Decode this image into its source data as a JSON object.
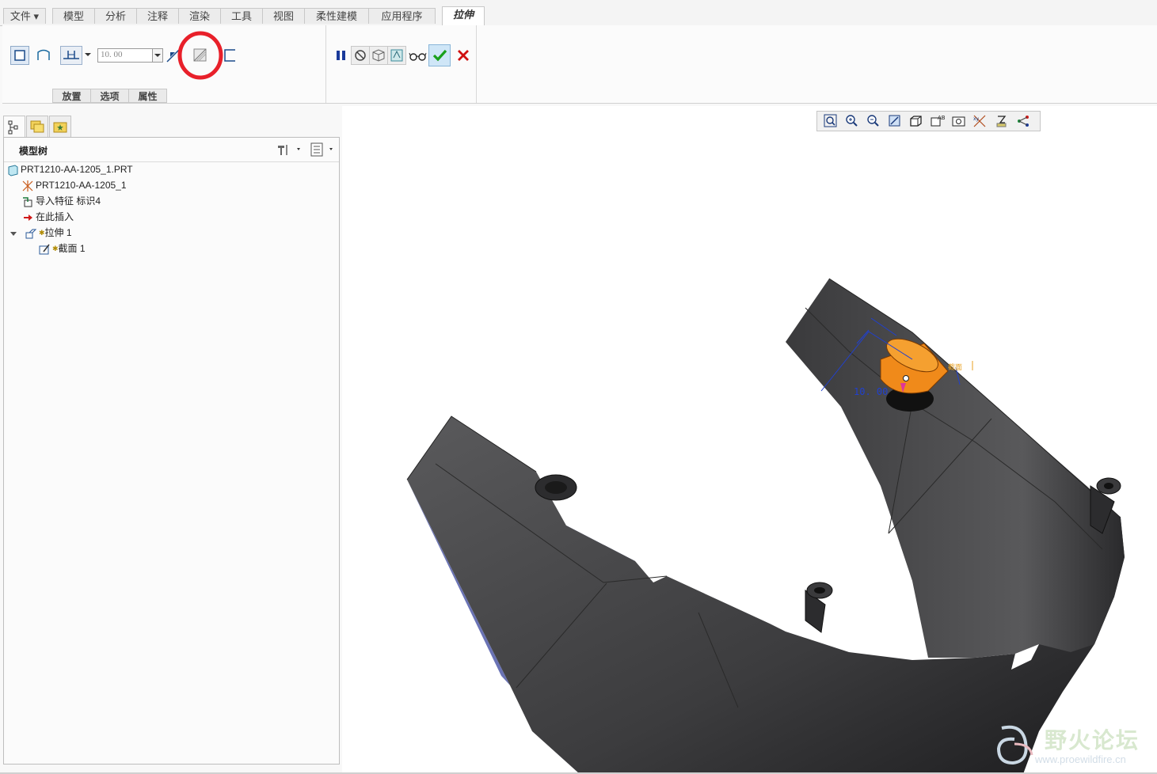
{
  "menu": {
    "tabs": [
      {
        "label": "文件 ▾"
      },
      {
        "label": "模型"
      },
      {
        "label": "分析"
      },
      {
        "label": "注释"
      },
      {
        "label": "渲染"
      },
      {
        "label": "工具"
      },
      {
        "label": "视图"
      },
      {
        "label": "柔性建模"
      },
      {
        "label": "应用程序"
      },
      {
        "label": "拉伸",
        "active": true
      }
    ]
  },
  "ribbon": {
    "depth_value": "10. 00",
    "subtabs": [
      {
        "label": "放置"
      },
      {
        "label": "选项"
      },
      {
        "label": "属性"
      }
    ],
    "confirm_color": "#1aa01a",
    "cancel_color": "#d01010",
    "highlight_color": "#e8202a"
  },
  "model_tree": {
    "title": "模型树",
    "items": [
      {
        "label": "PRT1210-AA-1205_1.PRT",
        "icon": "part-icon"
      },
      {
        "label": "PRT1210-AA-1205_1",
        "icon": "coordinate-system-icon"
      },
      {
        "label": "导入特征 标识4",
        "icon": "import-feature-icon"
      },
      {
        "label": "在此插入",
        "icon": "insert-here-arrow-icon"
      },
      {
        "label": "拉伸 1",
        "icon": "extrude-icon"
      },
      {
        "label": "截面 1",
        "icon": "sketch-icon"
      }
    ]
  },
  "viewport": {
    "dimension_label": "10. 00",
    "section_label": "截面"
  },
  "watermark": {
    "title": "野火论坛",
    "url": "www.proewildfire.cn"
  }
}
